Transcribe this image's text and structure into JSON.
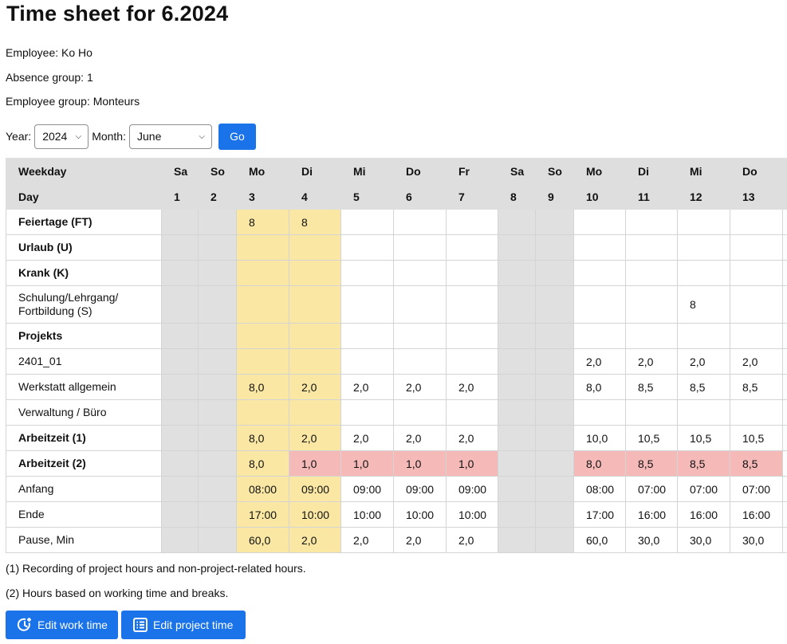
{
  "title": "Time sheet for 6.2024",
  "employee_line": "Employee: Ko Ho",
  "absence_line": "Absence group: 1",
  "group_line": "Employee group: Monteurs",
  "filter": {
    "year_label": "Year:",
    "year_value": "2024",
    "month_label": "Month:",
    "month_value": "June",
    "go_label": "Go"
  },
  "table": {
    "weekday_header": "Weekday",
    "day_header": "Day",
    "columns": [
      {
        "wd": "Sa",
        "d": "1",
        "type": "we"
      },
      {
        "wd": "So",
        "d": "2",
        "type": "we"
      },
      {
        "wd": "Mo",
        "d": "3",
        "type": "hol"
      },
      {
        "wd": "Di",
        "d": "4",
        "type": "hol"
      },
      {
        "wd": "Mi",
        "d": "5",
        "type": ""
      },
      {
        "wd": "Do",
        "d": "6",
        "type": ""
      },
      {
        "wd": "Fr",
        "d": "7",
        "type": ""
      },
      {
        "wd": "Sa",
        "d": "8",
        "type": "we"
      },
      {
        "wd": "So",
        "d": "9",
        "type": "we"
      },
      {
        "wd": "Mo",
        "d": "10",
        "type": ""
      },
      {
        "wd": "Di",
        "d": "11",
        "type": ""
      },
      {
        "wd": "Mi",
        "d": "12",
        "type": ""
      },
      {
        "wd": "Do",
        "d": "13",
        "type": ""
      },
      {
        "wd": "",
        "d": "",
        "type": ""
      }
    ],
    "rows": [
      {
        "label": "Feiertage (FT)",
        "bold": true,
        "values": [
          "",
          "",
          "8",
          "8",
          "",
          "",
          "",
          "",
          "",
          "",
          "",
          "",
          "",
          ""
        ]
      },
      {
        "label": "Urlaub (U)",
        "bold": true,
        "values": [
          "",
          "",
          "",
          "",
          "",
          "",
          "",
          "",
          "",
          "",
          "",
          "",
          "",
          ""
        ]
      },
      {
        "label": "Krank (K)",
        "bold": true,
        "values": [
          "",
          "",
          "",
          "",
          "",
          "",
          "",
          "",
          "",
          "",
          "",
          "",
          "",
          ""
        ]
      },
      {
        "label": "Schulung/Lehrgang/ Fortbildung (S)",
        "bold": false,
        "tall": true,
        "values": [
          "",
          "",
          "",
          "",
          "",
          "",
          "",
          "",
          "",
          "",
          "",
          "8",
          "",
          ""
        ]
      },
      {
        "label": "Projekts",
        "bold": true,
        "values": [
          "",
          "",
          "",
          "",
          "",
          "",
          "",
          "",
          "",
          "",
          "",
          "",
          "",
          ""
        ]
      },
      {
        "label": "2401_01",
        "bold": false,
        "values": [
          "",
          "",
          "",
          "",
          "",
          "",
          "",
          "",
          "",
          "2,0",
          "2,0",
          "2,0",
          "2,0",
          ""
        ]
      },
      {
        "label": "Werkstatt allgemein",
        "bold": false,
        "values": [
          "",
          "",
          "8,0",
          "2,0",
          "2,0",
          "2,0",
          "2,0",
          "",
          "",
          "8,0",
          "8,5",
          "8,5",
          "8,5",
          ""
        ]
      },
      {
        "label": "Verwaltung / Büro",
        "bold": false,
        "values": [
          "",
          "",
          "",
          "",
          "",
          "",
          "",
          "",
          "",
          "",
          "",
          "",
          "",
          ""
        ]
      },
      {
        "label": "Arbeitzeit (1)",
        "bold": true,
        "values": [
          "",
          "",
          "8,0",
          "2,0",
          "2,0",
          "2,0",
          "2,0",
          "",
          "",
          "10,0",
          "10,5",
          "10,5",
          "10,5",
          ""
        ]
      },
      {
        "label": "Arbeitzeit (2)",
        "bold": true,
        "highlight": true,
        "values": [
          "",
          "",
          "8,0",
          "1,0",
          "1,0",
          "1,0",
          "1,0",
          "",
          "",
          "8,0",
          "8,5",
          "8,5",
          "8,5",
          ""
        ]
      },
      {
        "label": "Anfang",
        "bold": false,
        "values": [
          "",
          "",
          "08:00",
          "09:00",
          "09:00",
          "09:00",
          "09:00",
          "",
          "",
          "08:00",
          "07:00",
          "07:00",
          "07:00",
          ""
        ]
      },
      {
        "label": "Ende",
        "bold": false,
        "values": [
          "",
          "",
          "17:00",
          "10:00",
          "10:00",
          "10:00",
          "10:00",
          "",
          "",
          "17:00",
          "16:00",
          "16:00",
          "16:00",
          ""
        ]
      },
      {
        "label": "Pause, Min",
        "bold": false,
        "values": [
          "",
          "",
          "60,0",
          "2,0",
          "2,0",
          "2,0",
          "2,0",
          "",
          "",
          "60,0",
          "30,0",
          "30,0",
          "30,0",
          ""
        ]
      }
    ]
  },
  "notes": {
    "n1": "(1) Recording of project hours and non-project-related hours.",
    "n2": "(2) Hours based on working time and breaks."
  },
  "buttons": {
    "edit_work": "Edit work time",
    "edit_project": "Edit project time",
    "edit_work_icon": "clock-plus-icon",
    "edit_project_icon": "list-icon"
  },
  "colors": {
    "accent": "#1a73e8",
    "weekend": "#e0e0e0",
    "holiday": "#f9e7a3",
    "deficit": "#f5b9b8",
    "header": "#dedede"
  }
}
